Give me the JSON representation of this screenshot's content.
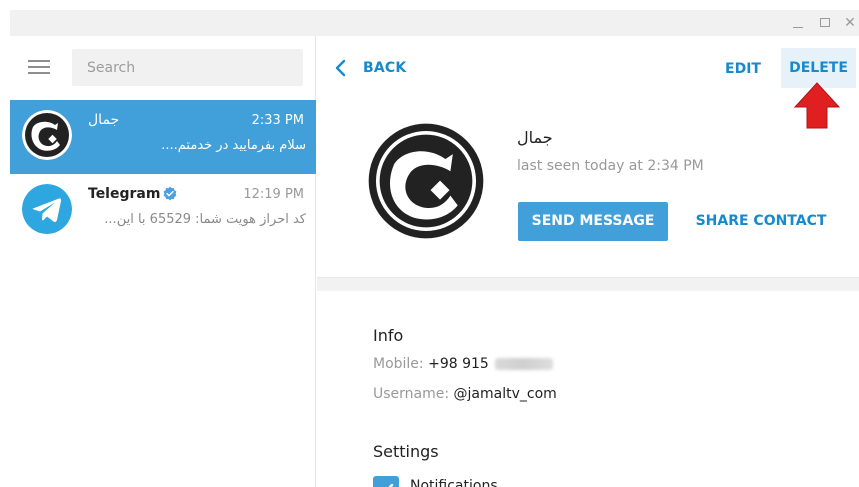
{
  "window": {
    "minimize_symbol": "",
    "maximize_symbol": "",
    "close_symbol": "✕"
  },
  "sidebar": {
    "search_placeholder": "Search",
    "chats": [
      {
        "name": "جمال",
        "time": "2:33 PM",
        "preview": "سلام بفرمایید در خدمتم....",
        "avatar": "jim-logo-icon",
        "active": true
      },
      {
        "name": "Telegram",
        "time": "12:19 PM",
        "preview": "کد احراز هویت شما: 65529 با این...",
        "avatar": "telegram-logo-icon",
        "verified": true,
        "active": false
      }
    ]
  },
  "header": {
    "back_label": "BACK",
    "edit_label": "EDIT",
    "delete_label": "DELETE"
  },
  "profile": {
    "name": "جمال",
    "last_seen": "last seen today at 2:34 PM",
    "send_message_label": "SEND MESSAGE",
    "share_contact_label": "SHARE CONTACT"
  },
  "info": {
    "title": "Info",
    "mobile_label": "Mobile:",
    "mobile_value": "+98 915",
    "username_label": "Username:",
    "username_value": "@jamaltv_com"
  },
  "settings": {
    "title": "Settings",
    "notifications_label": "Notifications"
  },
  "colors": {
    "accent": "#419fd9",
    "link": "#168acd",
    "active_chat": "#419fd9",
    "delete_highlight": "#e6f1fa",
    "arrow": "#e02020"
  }
}
